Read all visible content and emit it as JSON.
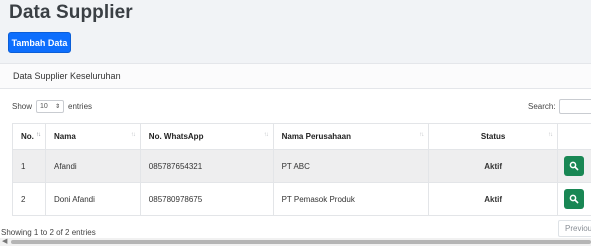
{
  "page": {
    "title": "Data Supplier"
  },
  "toolbar": {
    "add_label": "Tambah Data"
  },
  "card": {
    "title": "Data Supplier Keseluruhan"
  },
  "length": {
    "prefix": "Show",
    "value": "10",
    "suffix": "entries"
  },
  "search": {
    "label": "Search:",
    "value": ""
  },
  "table": {
    "headers": [
      "No.",
      "Nama",
      "No. WhatsApp",
      "Nama Perusahaan",
      "Status"
    ],
    "rows": [
      {
        "no": "1",
        "nama": "Afandi",
        "whatsapp": "085787654321",
        "perusahaan": "PT ABC",
        "status": "Aktif"
      },
      {
        "no": "2",
        "nama": "Doni Afandi",
        "whatsapp": "085780978675",
        "perusahaan": "PT Pemasok Produk",
        "status": "Aktif"
      }
    ]
  },
  "footer": {
    "info": "Showing 1 to 2 of 2 entries",
    "previous": "Previous"
  },
  "colors": {
    "primary": "#0d6efd",
    "success": "#198754"
  },
  "icons": {
    "view": "search-icon"
  }
}
